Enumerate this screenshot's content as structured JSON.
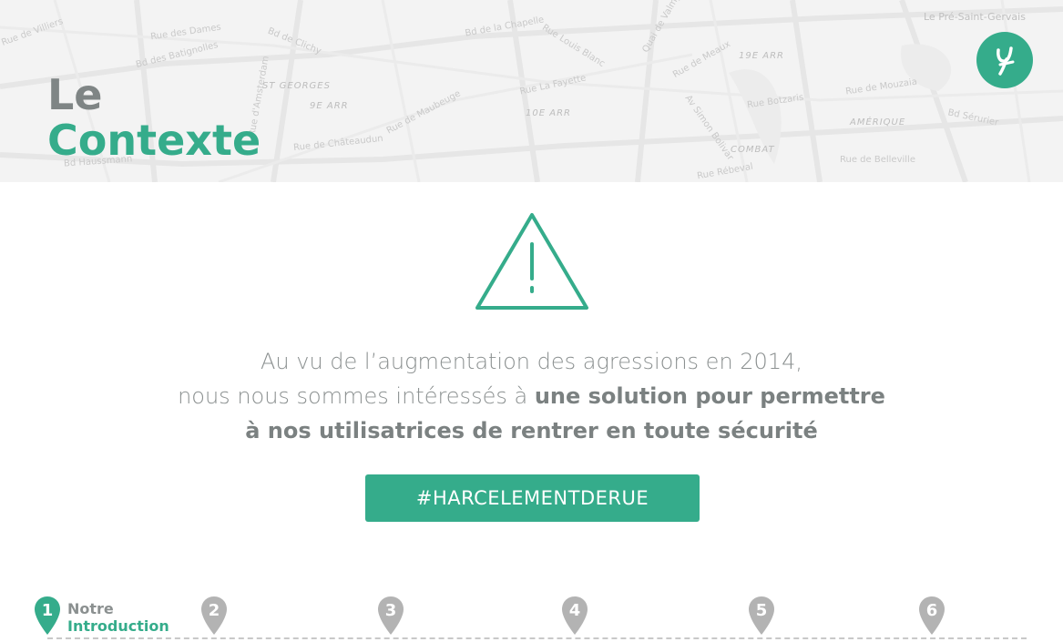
{
  "header": {
    "title_line1": "Le",
    "title_line2": "Contexte",
    "map_labels": [
      "Le Pré-Saint-Gervais",
      "Bd de la Chapelle",
      "Rue des Dames",
      "Bd des Batignolles",
      "Bd de Clichy",
      "ST GEORGES",
      "9E ARR",
      "Rue de Maubeuge",
      "Rue La Fayette",
      "10E ARR",
      "19E ARR",
      "Rue Louis Blanc",
      "Rue de Meaux",
      "Rue de Mouzaia",
      "Rue Botzaris",
      "AMÉRIQUE",
      "Bd Sérurier",
      "COMBAT",
      "Rue de Belleville",
      "Bd Haussmann",
      "Rue de Châteaudun",
      "Av Simon Bolivar",
      "Rue Rébeval",
      "Quai de Valmy",
      "Rue de Villiers",
      "Rue d'Amsterdam"
    ],
    "logo_icon": "yuzz-logo-icon"
  },
  "main": {
    "warning_icon": "warning-triangle-icon",
    "intro_line1": "Au vu de l’augmentation des agressions en 2014,",
    "intro_line2_normal": "nous nous sommes intéressés à ",
    "intro_line2_bold": "une solution pour permettre",
    "intro_line3_bold": "à nos utilisatrices de rentrer en toute sécurité",
    "hashtag_button": "#HARCELEMENTDERUE"
  },
  "timeline": {
    "steps": [
      "1",
      "2",
      "3",
      "4",
      "5",
      "6"
    ],
    "active_step": "1",
    "active_label_line1": "Notre",
    "active_label_line2": "Introduction"
  },
  "colors": {
    "accent": "#35ac8b",
    "text_gray": "#8b9090",
    "inactive_marker": "#b3b3b3",
    "header_bg": "#f3f3f3"
  }
}
